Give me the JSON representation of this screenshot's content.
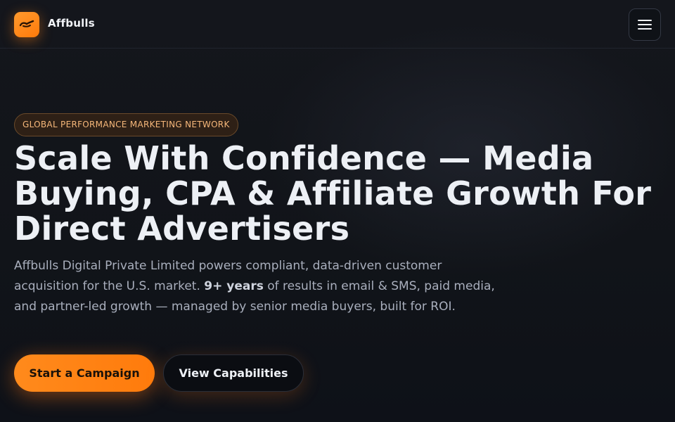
{
  "header": {
    "brand": "Affbulls",
    "logo_icon": "bull-horns-icon",
    "menu_icon": "hamburger-menu-icon"
  },
  "hero": {
    "eyebrow": "GLOBAL PERFORMANCE MARKETING NETWORK",
    "headline": "Scale With Confidence — Media Buying, CPA & Affiliate Growth For Direct Advertisers",
    "lead_part1": "Affbulls Digital Private Limited powers compliant, data-driven customer acquisition for the U.S. market. ",
    "lead_highlight": "9+ years",
    "lead_part2": " of results in email & SMS, paid media, and partner-led growth — managed by senior media buyers, built for ROI.",
    "primary_cta": "Start a Campaign",
    "secondary_cta": "View Capabilities"
  },
  "colors": {
    "accent": "#ff8a1c",
    "background": "#0e1118",
    "eyebrow_text": "#f6b77a"
  }
}
